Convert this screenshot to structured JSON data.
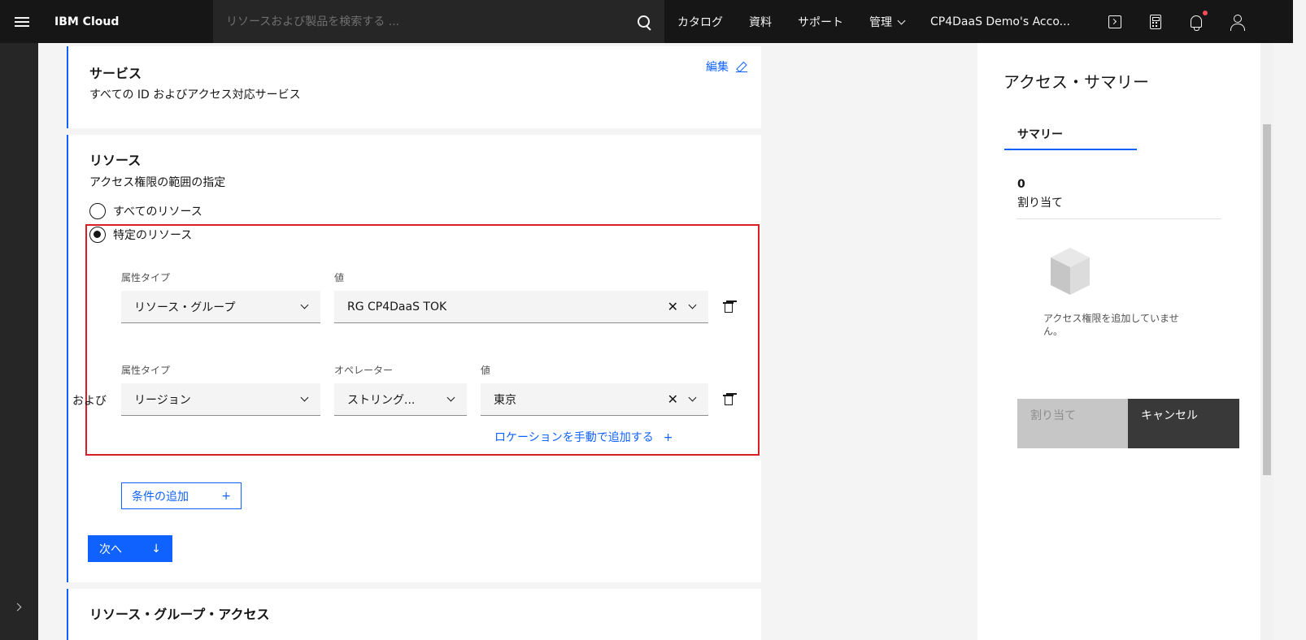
{
  "header": {
    "brand": "IBM Cloud",
    "search_placeholder": "リソースおよび製品を検索する ...",
    "nav": [
      "カタログ",
      "資料",
      "サポート",
      "管理"
    ],
    "account": "CP4DaaS Demo's Acco..."
  },
  "services": {
    "title": "サービス",
    "desc": "すべての ID およびアクセス対応サービス",
    "edit": "編集"
  },
  "resources": {
    "title": "リソース",
    "desc": "アクセス権限の範囲の指定",
    "option_all": "すべてのリソース",
    "option_specific": "特定のリソース",
    "row1": {
      "attr_label": "属性タイプ",
      "attr_value": "リソース・グループ",
      "value_label": "値",
      "value": "RG CP4DaaS TOK"
    },
    "and_label": "および",
    "row2": {
      "attr_label": "属性タイプ",
      "attr_value": "リージョン",
      "op_label": "オペレーター",
      "op_value": "ストリング...",
      "value_label": "値",
      "value": "東京"
    },
    "manual_location": "ロケーションを手動で追加する",
    "add_condition": "条件の追加",
    "next": "次へ"
  },
  "next_section_title": "リソース・グループ・アクセス",
  "summary": {
    "title": "アクセス・サマリー",
    "tab": "サマリー",
    "count": "0",
    "count_label": "割り当て",
    "empty": "アクセス権限を追加していません。",
    "assign": "割り当て",
    "cancel": "キャンセル"
  }
}
